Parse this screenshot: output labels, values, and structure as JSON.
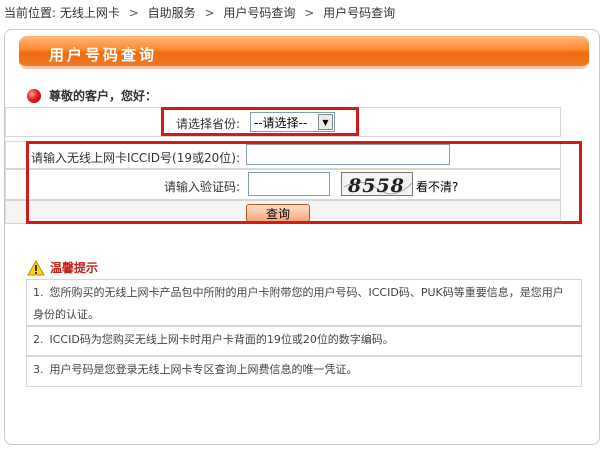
{
  "breadcrumb": {
    "prefix": "当前位置:",
    "items": [
      "无线上网卡",
      "自助服务",
      "用户号码查询",
      "用户号码查询"
    ],
    "separator": ">"
  },
  "panel": {
    "title": "用户号码查询",
    "greeting": "尊敬的客户，您好："
  },
  "form": {
    "province_label": "请选择省份:",
    "province_selected": "--请选择--",
    "iccid_label": "请输入无线上网卡ICCID号(19或20位):",
    "iccid_value": "",
    "captcha_label": "请输入验证码:",
    "captcha_value": "",
    "captcha_text": "8558",
    "refresh_label": "看不清?",
    "query_label": "查询"
  },
  "tips": {
    "title": "温馨提示",
    "items": [
      {
        "num": "1.",
        "text": "您所购买的无线上网卡产品包中所附的用户卡附带您的用户号码、ICCID码、PUK码等重要信息，是您用户身份的认证。"
      },
      {
        "num": "2.",
        "text": "ICCID码为您购买无线上网卡时用户卡背面的19位或20位的数字编码。"
      },
      {
        "num": "3.",
        "text": "用户号码是您登录无线上网卡专区查询上网费信息的唯一凭证。"
      }
    ]
  },
  "colors": {
    "title_bar": "#f07a20",
    "highlight_box": "#d11b1b",
    "tips_title": "#c0241a"
  }
}
